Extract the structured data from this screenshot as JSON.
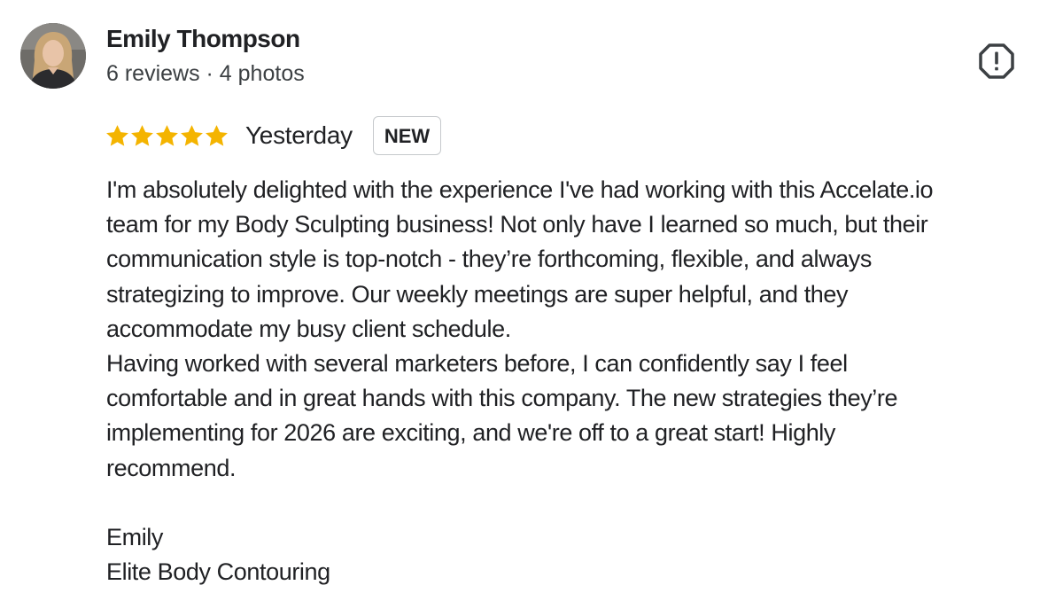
{
  "reviewer": {
    "name": "Emily Thompson",
    "meta": "6 reviews · 4 photos"
  },
  "rating": {
    "stars": 5,
    "max_stars": 5,
    "star_color": "#f4b400",
    "time": "Yesterday",
    "badge": "NEW"
  },
  "review_lines": [
    "I'm absolutely delighted with the experience I've had working with this Accelate.io",
    "team for my Body Sculpting business! Not only have I learned so much, but their",
    "communication style is top-notch - they’re forthcoming, flexible, and always",
    "strategizing to improve. Our weekly meetings are super helpful, and they",
    "accommodate my busy client schedule.",
    "Having worked with several marketers before, I can confidently say I feel",
    "comfortable and in great hands with this company. The new strategies they’re",
    "implementing for 2026 are exciting, and we're off to a great start! Highly",
    "recommend.",
    "",
    "Emily",
    "Elite Body Contouring"
  ],
  "icons": {
    "report": "report-flag-icon",
    "star": "star-icon",
    "avatar": "avatar-photo"
  }
}
